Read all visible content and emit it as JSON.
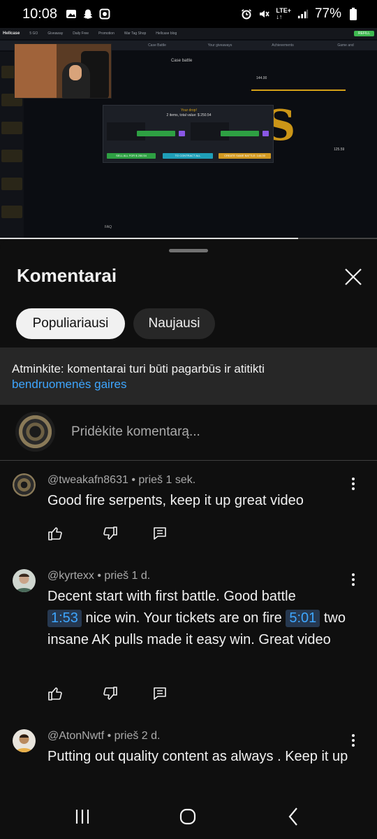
{
  "status_bar": {
    "time": "10:08",
    "network": "LTE+",
    "battery": "77%"
  },
  "video": {
    "site_logo": "Hellcase",
    "topbar_items": [
      "5 GO",
      "Giveaway",
      "Daily Free",
      "Promotion",
      "War Tag Shop",
      "Hellcase blog"
    ],
    "topbar_button": "REFILL",
    "nav_items": [
      "Contract",
      "Event",
      "Case Battle",
      "Your giveaways",
      "Achievements",
      "Game and"
    ],
    "page_header": "Case battle",
    "modal_title": "Your drop!",
    "modal_subtitle": "2 items, total value: $ 250.54",
    "modal_sell_all": "SELL ALL FOR $ 250.54",
    "modal_contract": "TO CONTRACT ALL",
    "modal_create": "CREATE SAME BATTLE: 144.00",
    "side_value_1": "144.00",
    "side_value_2": "125.59",
    "faq": "FAQ",
    "progress_fraction": 0.79
  },
  "panel": {
    "title": "Komentarai",
    "chips": [
      "Populiariausi",
      "Naujausi"
    ],
    "notice_text": "Atminkite: komentarai turi būti pagarbūs ir atitikti",
    "notice_link": "bendruomenės gaires",
    "add_comment_placeholder": "Pridėkite komentarą..."
  },
  "comments": [
    {
      "author": "@tweakafn8631",
      "time": "prieš 1 sek.",
      "text": "Good fire serpents, keep it up great video"
    },
    {
      "author": "@kyrtexx",
      "time": "prieš 1 d.",
      "text_part1": "Decent start with first battle. Good battle",
      "timestamp1": "1:53",
      "text_part2": "nice win. Your tickets are on fire",
      "timestamp2": "5:01",
      "text_part3": "two insane AK pulls made it easy win. Great video"
    },
    {
      "author": "@AtonNwtf",
      "time": "prieš 2 d.",
      "text": "Putting out quality content as always . Keep it up"
    }
  ],
  "colors": {
    "background": "#0f0f0f",
    "surface": "#272727",
    "link": "#3ea6ff",
    "secondary_text": "#aaaaaa"
  }
}
